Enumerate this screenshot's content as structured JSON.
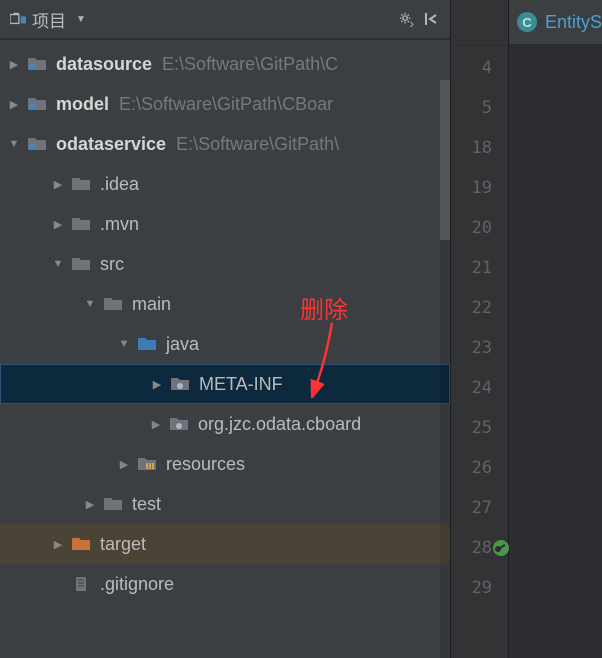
{
  "toolbar": {
    "title": "项目"
  },
  "tree": [
    {
      "depth": 0,
      "exp": "right",
      "icon": "module",
      "label": "datasource",
      "bold": true,
      "path": "E:\\Software\\GitPath\\C",
      "sel": false,
      "hl": false
    },
    {
      "depth": 0,
      "exp": "right",
      "icon": "module",
      "label": "model",
      "bold": true,
      "path": "E:\\Software\\GitPath\\CBoar",
      "sel": false,
      "hl": false
    },
    {
      "depth": 0,
      "exp": "down",
      "icon": "module",
      "label": "odataservice",
      "bold": true,
      "path": "E:\\Software\\GitPath\\",
      "sel": false,
      "hl": false
    },
    {
      "depth": 1,
      "exp": "right",
      "icon": "folder",
      "label": ".idea",
      "bold": false,
      "path": "",
      "sel": false,
      "hl": false
    },
    {
      "depth": 1,
      "exp": "right",
      "icon": "folder",
      "label": ".mvn",
      "bold": false,
      "path": "",
      "sel": false,
      "hl": false
    },
    {
      "depth": 1,
      "exp": "down",
      "icon": "folder",
      "label": "src",
      "bold": false,
      "path": "",
      "sel": false,
      "hl": false
    },
    {
      "depth": 2,
      "exp": "down",
      "icon": "folder",
      "label": "main",
      "bold": false,
      "path": "",
      "sel": false,
      "hl": false
    },
    {
      "depth": 3,
      "exp": "down",
      "icon": "source",
      "label": "java",
      "bold": false,
      "path": "",
      "sel": false,
      "hl": false
    },
    {
      "depth": 4,
      "exp": "right",
      "icon": "package",
      "label": "META-INF",
      "bold": false,
      "path": "",
      "sel": true,
      "hl": false
    },
    {
      "depth": 4,
      "exp": "right",
      "icon": "package",
      "label": "org.jzc.odata.cboard",
      "bold": false,
      "path": "",
      "sel": false,
      "hl": false
    },
    {
      "depth": 3,
      "exp": "right",
      "icon": "resources",
      "label": "resources",
      "bold": false,
      "path": "",
      "sel": false,
      "hl": false
    },
    {
      "depth": 2,
      "exp": "right",
      "icon": "folder",
      "label": "test",
      "bold": false,
      "path": "",
      "sel": false,
      "hl": false
    },
    {
      "depth": 1,
      "exp": "right",
      "icon": "excluded",
      "label": "target",
      "bold": false,
      "path": "",
      "sel": false,
      "hl": true
    },
    {
      "depth": 1,
      "exp": "none",
      "icon": "file",
      "label": ".gitignore",
      "bold": false,
      "path": "",
      "sel": false,
      "hl": false
    }
  ],
  "annotation": {
    "text": "删除"
  },
  "gutter_lines": [
    "4",
    "5",
    "18",
    "19",
    "20",
    "21",
    "22",
    "23",
    "24",
    "25",
    "26",
    "27",
    "28",
    "29"
  ],
  "gutter_mark_line": "28",
  "tab": {
    "icon_letter": "C",
    "label": "EntityS"
  }
}
